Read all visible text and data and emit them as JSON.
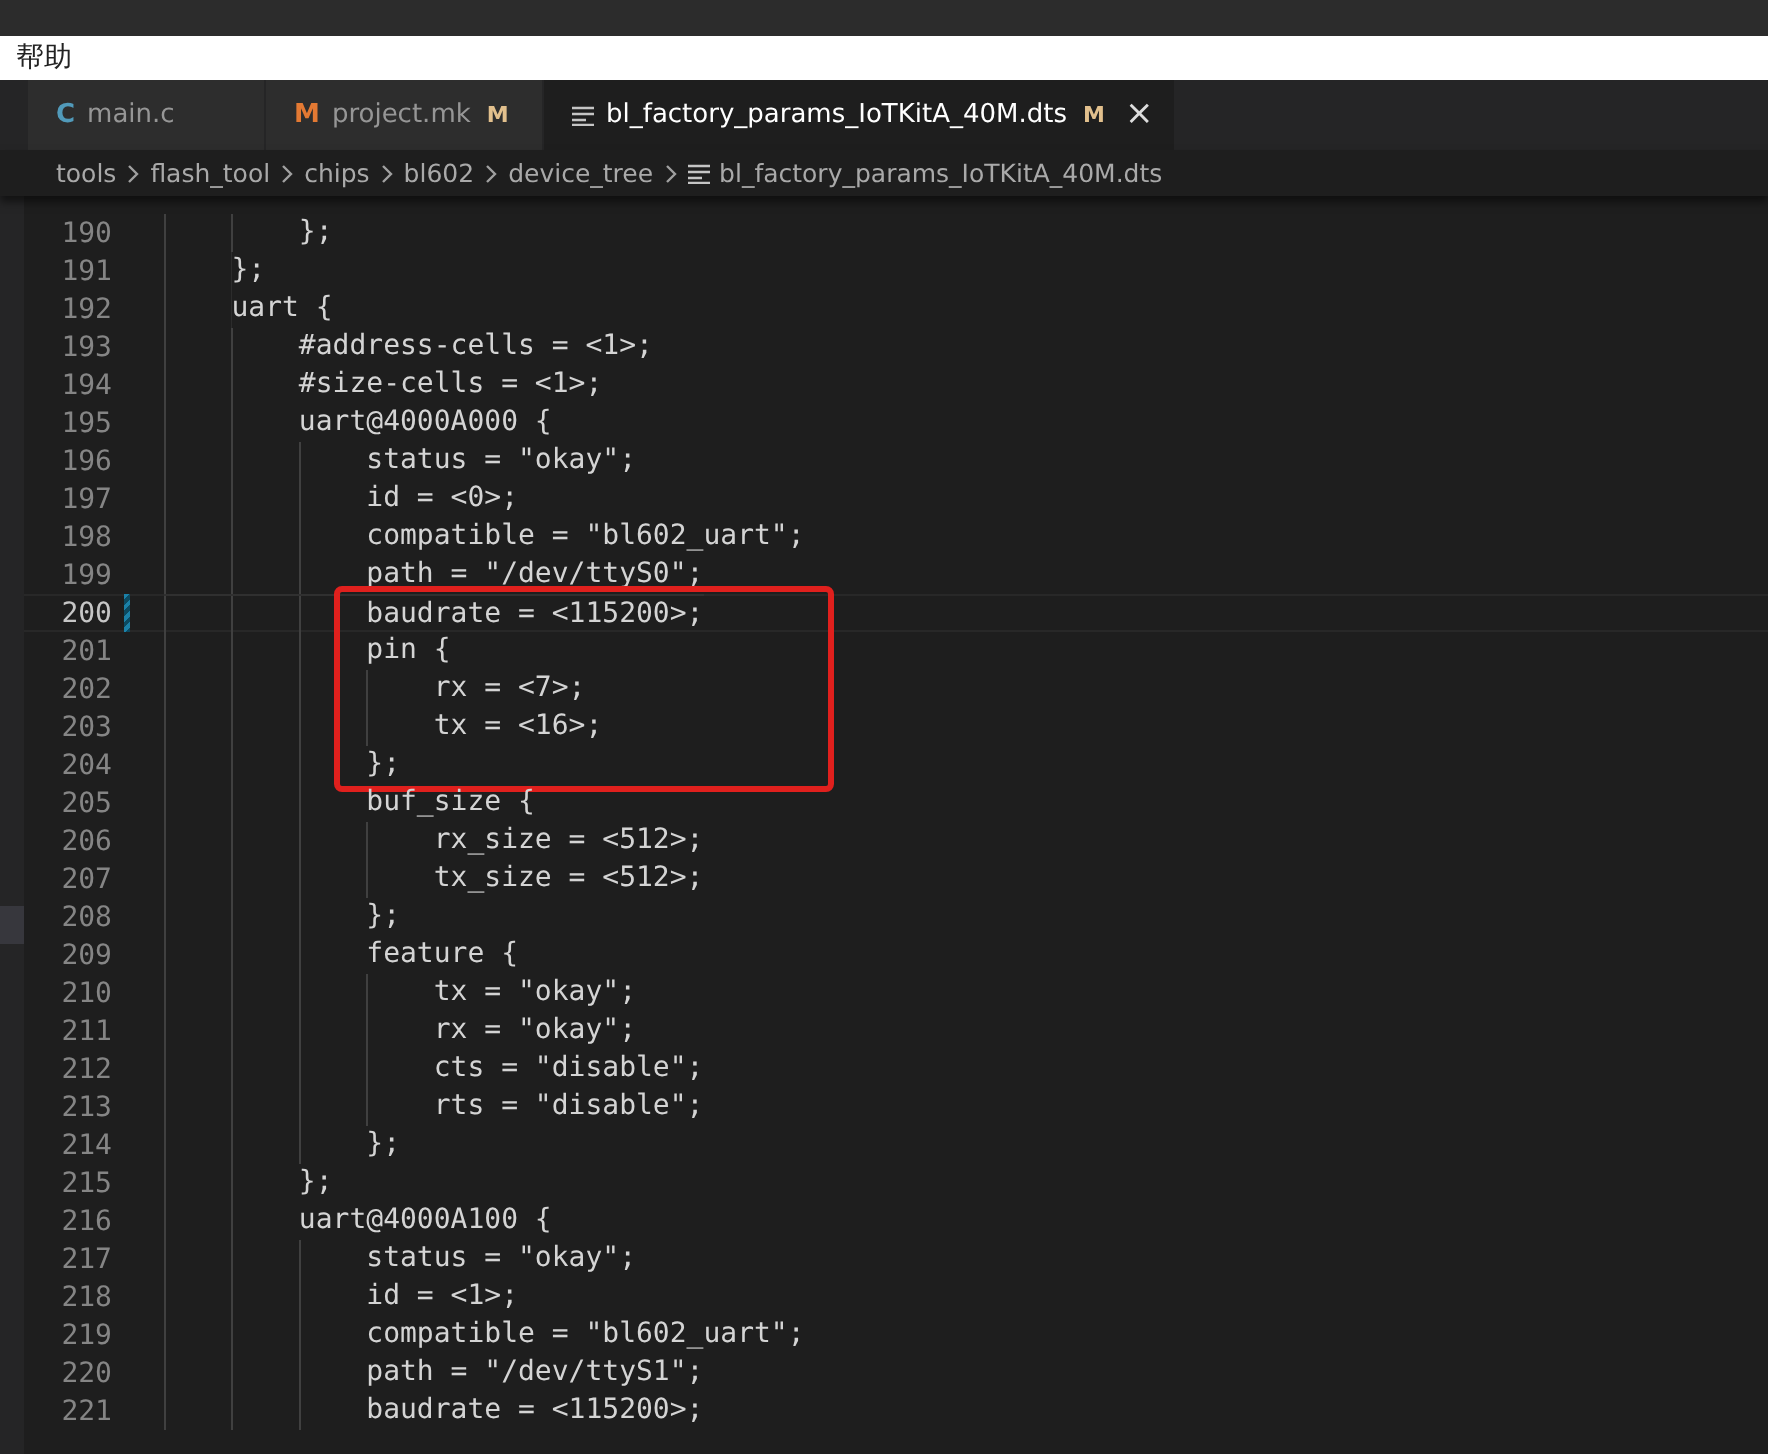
{
  "menu": [
    "帮助"
  ],
  "tabs": [
    {
      "kind": "c",
      "icon_text": "C",
      "label": "main.c",
      "selected": false,
      "closable": false
    },
    {
      "kind": "make",
      "icon_text": "M",
      "label": "project.mk",
      "badge": "M",
      "selected": false,
      "closable": false
    },
    {
      "kind": "file",
      "label": "bl_factory_params_IoTKitA_40M.dts",
      "badge": "M",
      "selected": true,
      "closable": true
    }
  ],
  "close_glyph": "×",
  "breadcrumb": [
    {
      "label": "tools",
      "kind": "folder"
    },
    {
      "label": "flash_tool",
      "kind": "folder"
    },
    {
      "label": "chips",
      "kind": "folder"
    },
    {
      "label": "bl602",
      "kind": "folder"
    },
    {
      "label": "device_tree",
      "kind": "folder"
    },
    {
      "label": "bl_factory_params_IoTKitA_40M.dts",
      "kind": "file"
    }
  ],
  "code_blocks": [
    {
      "kind": "plain",
      "lines": [
        {
          "number": "190",
          "text": "        };",
          "current": false,
          "modified": false
        },
        {
          "number": "191",
          "text": "    };",
          "current": false,
          "modified": false
        },
        {
          "number": "192",
          "text": "    uart {",
          "current": false,
          "modified": false
        },
        {
          "number": "193",
          "text": "        #address-cells = <1>;",
          "current": false,
          "modified": false
        },
        {
          "number": "194",
          "text": "        #size-cells = <1>;",
          "current": false,
          "modified": false
        },
        {
          "number": "195",
          "text": "        uart@4000A000 {",
          "current": false,
          "modified": false
        },
        {
          "number": "196",
          "text": "            status = \"okay\";",
          "current": false,
          "modified": false
        },
        {
          "number": "197",
          "text": "            id = <0>;",
          "current": false,
          "modified": false
        },
        {
          "number": "198",
          "text": "            compatible = \"bl602_uart\";",
          "current": false,
          "modified": false
        },
        {
          "number": "199",
          "text": "            path = \"/dev/ttyS0\";",
          "current": false,
          "modified": false
        }
      ]
    },
    {
      "kind": "boxed",
      "lines": [
        {
          "number": "200",
          "text": "            baudrate = <115200>;",
          "current": true,
          "modified": true
        },
        {
          "number": "201",
          "text": "            pin {",
          "current": false,
          "modified": false
        },
        {
          "number": "202",
          "text": "                rx = <7>;",
          "current": false,
          "modified": false
        },
        {
          "number": "203",
          "text": "                tx = <16>;",
          "current": false,
          "modified": false
        },
        {
          "number": "204",
          "text": "            };",
          "current": false,
          "modified": false
        }
      ]
    },
    {
      "kind": "plain",
      "lines": [
        {
          "number": "205",
          "text": "            buf_size {",
          "current": false,
          "modified": false
        },
        {
          "number": "206",
          "text": "                rx_size = <512>;",
          "current": false,
          "modified": false
        },
        {
          "number": "207",
          "text": "                tx_size = <512>;",
          "current": false,
          "modified": false
        },
        {
          "number": "208",
          "text": "            };",
          "current": false,
          "modified": false
        },
        {
          "number": "209",
          "text": "            feature {",
          "current": false,
          "modified": false
        },
        {
          "number": "210",
          "text": "                tx = \"okay\";",
          "current": false,
          "modified": false
        },
        {
          "number": "211",
          "text": "                rx = \"okay\";",
          "current": false,
          "modified": false
        },
        {
          "number": "212",
          "text": "                cts = \"disable\";",
          "current": false,
          "modified": false
        },
        {
          "number": "213",
          "text": "                rts = \"disable\";",
          "current": false,
          "modified": false
        },
        {
          "number": "214",
          "text": "            };",
          "current": false,
          "modified": false
        },
        {
          "number": "215",
          "text": "        };",
          "current": false,
          "modified": false
        },
        {
          "number": "216",
          "text": "        uart@4000A100 {",
          "current": false,
          "modified": false
        },
        {
          "number": "217",
          "text": "            status = \"okay\";",
          "current": false,
          "modified": false
        },
        {
          "number": "218",
          "text": "            id = <1>;",
          "current": false,
          "modified": false
        },
        {
          "number": "219",
          "text": "            compatible = \"bl602_uart\";",
          "current": false,
          "modified": false
        },
        {
          "number": "220",
          "text": "            path = \"/dev/ttyS1\";",
          "current": false,
          "modified": false
        },
        {
          "number": "221",
          "text": "            baudrate = <115200>;",
          "current": false,
          "modified": false
        }
      ]
    }
  ]
}
